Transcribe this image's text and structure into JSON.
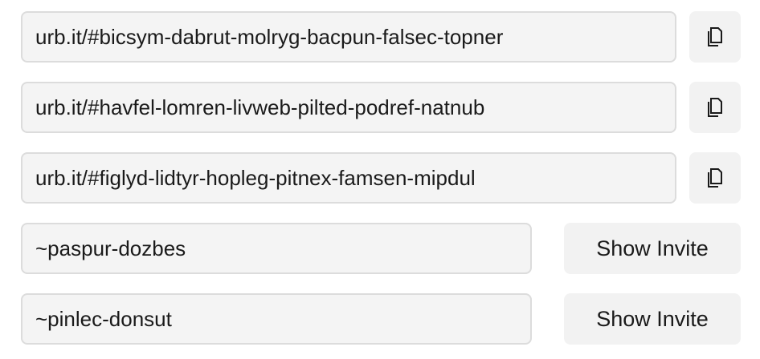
{
  "invites": [
    {
      "url": "urb.it/#bicsym-dabrut-molryg-bacpun-falsec-topner",
      "copy_icon": "copy-icon"
    },
    {
      "url": "urb.it/#havfel-lomren-livweb-pilted-podref-natnub",
      "copy_icon": "copy-icon"
    },
    {
      "url": "urb.it/#figlyd-lidtyr-hopleg-pitnex-famsen-mipdul",
      "copy_icon": "copy-icon"
    }
  ],
  "ships": [
    {
      "name": "~paspur-dozbes",
      "button_label": "Show Invite"
    },
    {
      "name": "~pinlec-donsut",
      "button_label": "Show Invite"
    }
  ]
}
